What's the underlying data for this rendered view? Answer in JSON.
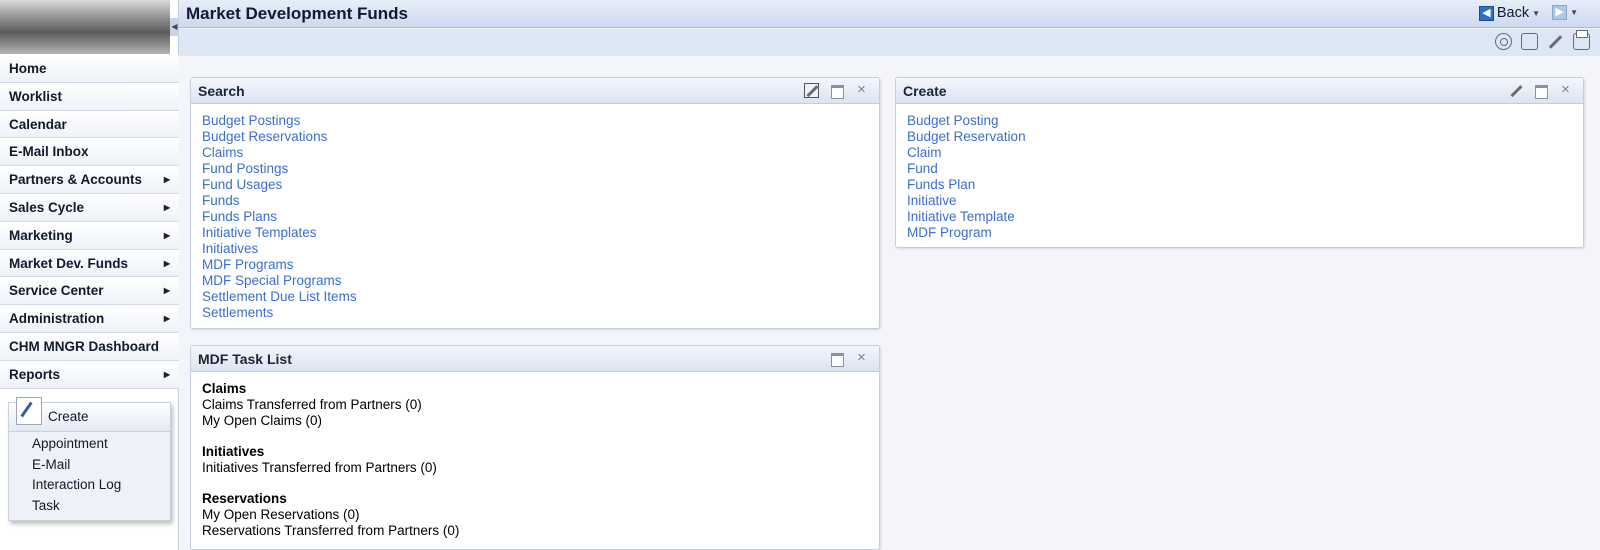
{
  "header": {
    "title": "Market Development Funds",
    "back_label": "Back"
  },
  "nav": {
    "items": [
      {
        "label": "Home",
        "submenu": false
      },
      {
        "label": "Worklist",
        "submenu": false
      },
      {
        "label": "Calendar",
        "submenu": false
      },
      {
        "label": "E-Mail Inbox",
        "submenu": false
      },
      {
        "label": "Partners & Accounts",
        "submenu": true
      },
      {
        "label": "Sales Cycle",
        "submenu": true
      },
      {
        "label": "Marketing",
        "submenu": true
      },
      {
        "label": "Market Dev. Funds",
        "submenu": true
      },
      {
        "label": "Service Center",
        "submenu": true
      },
      {
        "label": "Administration",
        "submenu": true
      },
      {
        "label": "CHM MNGR Dashboard",
        "submenu": false
      },
      {
        "label": "Reports",
        "submenu": true
      }
    ]
  },
  "quick_create": {
    "title": "Create",
    "items": [
      "Appointment",
      "E-Mail",
      "Interaction Log",
      "Task"
    ]
  },
  "search_panel": {
    "title": "Search",
    "links": [
      "Budget Postings",
      "Budget Reservations",
      "Claims",
      "Fund Postings",
      "Fund Usages",
      "Funds",
      "Funds Plans",
      "Initiative Templates",
      "Initiatives",
      "MDF Programs",
      "MDF Special Programs",
      "Settlement Due List Items",
      "Settlements"
    ]
  },
  "create_panel": {
    "title": "Create",
    "links": [
      "Budget Posting",
      "Budget Reservation",
      "Claim",
      "Fund",
      "Funds Plan",
      "Initiative",
      "Initiative Template",
      "MDF Program"
    ]
  },
  "task_panel": {
    "title": "MDF Task List",
    "groups": [
      {
        "heading": "Claims",
        "items": [
          "Claims Transferred from Partners (0)",
          "My Open Claims (0)"
        ]
      },
      {
        "heading": "Initiatives",
        "items": [
          "Initiatives Transferred from Partners (0)"
        ]
      },
      {
        "heading": "Reservations",
        "items": [
          "My Open Reservations (0)",
          "Reservations Transferred from Partners (0)"
        ]
      }
    ]
  },
  "colors": {
    "link": "#3a6ed0",
    "header_bg": "#cdd9ef",
    "page_bg": "#f3f5fb"
  }
}
